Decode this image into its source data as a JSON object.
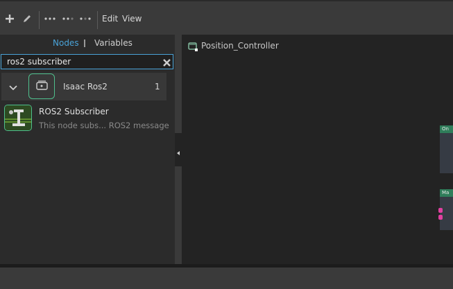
{
  "toolbar": {
    "add_icon": "plus-icon",
    "edit_icon": "pencil-icon",
    "edit_menu": "Edit",
    "view_menu": "View"
  },
  "panel": {
    "tabs": [
      "Nodes",
      "Variables"
    ],
    "active_tab": "Nodes",
    "search": {
      "value": "ros2 subscriber",
      "clear_icon": "close-icon"
    },
    "category": {
      "label": "Isaac Ros2",
      "count": "1",
      "icon": "ros-node-icon"
    },
    "node": {
      "title": "ROS2 Subscriber",
      "description": "This node subs... ROS2 message",
      "icon": "ros2-subscriber-icon"
    }
  },
  "graph": {
    "title": "Position_Controller",
    "nodes": [
      {
        "label": "On",
        "color": "#2f7d5a"
      },
      {
        "label": "Ma",
        "color": "#2f7d5a"
      }
    ]
  },
  "colors": {
    "accent": "#4aa3d8",
    "node_header": "#2f7d5a",
    "pin": "#e040a0"
  }
}
